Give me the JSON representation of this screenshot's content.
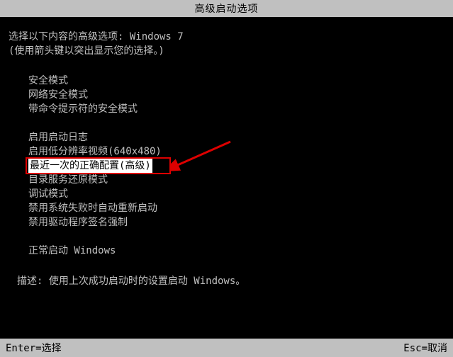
{
  "title": "高级启动选项",
  "intro_line1": "选择以下内容的高级选项: Windows 7",
  "intro_line2": "(使用箭头键以突出显示您的选择。)",
  "menu": {
    "group1": [
      "安全模式",
      "网络安全模式",
      "带命令提示符的安全模式"
    ],
    "group2": [
      "启用启动日志",
      "启用低分辨率视频(640x480)"
    ],
    "selected": "最近一次的正确配置(高级)",
    "group3": [
      "目录服务还原模式",
      "调试模式",
      "禁用系统失败时自动重新启动",
      "禁用驱动程序签名强制"
    ],
    "group4": [
      "正常启动 Windows"
    ]
  },
  "description": "描述: 使用上次成功启动时的设置启动 Windows。",
  "footer": {
    "enter": "Enter=选择",
    "esc": "Esc=取消"
  }
}
